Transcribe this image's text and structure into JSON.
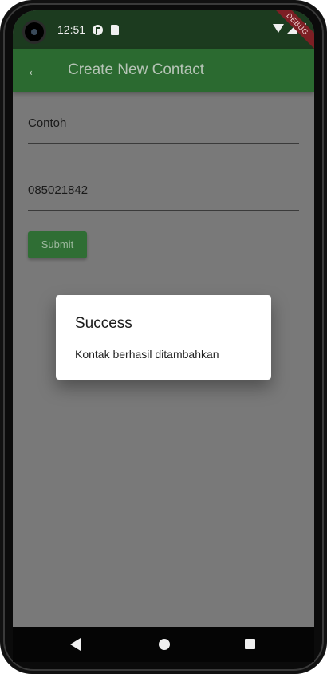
{
  "status_bar": {
    "time": "12:51",
    "debug_label": "DEBUG"
  },
  "app_bar": {
    "title": "Create New Contact",
    "back_icon": "arrow-left-icon"
  },
  "form": {
    "name_value": "Contoh",
    "phone_value": "085021842",
    "submit_label": "Submit"
  },
  "dialog": {
    "title": "Success",
    "message": "Kontak berhasil ditambahkan"
  },
  "colors": {
    "app_bar": "#2b6a30",
    "button": "#2f6e34",
    "scrim_background": "#797979"
  }
}
